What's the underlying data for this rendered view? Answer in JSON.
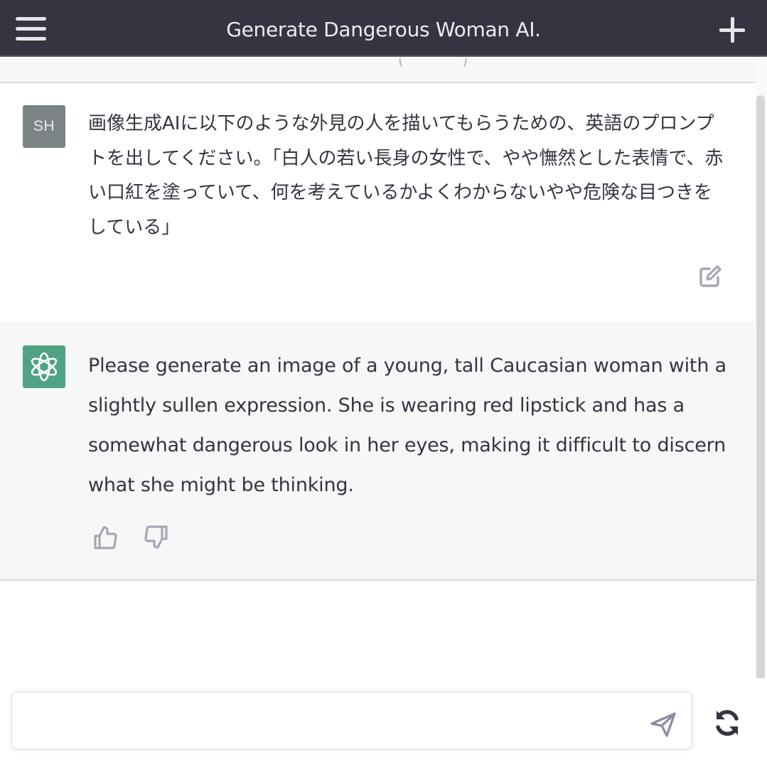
{
  "header": {
    "title": "Generate Dangerous Woman AI.",
    "menu_icon": "hamburger-menu-icon",
    "new_chat_icon": "plus-icon"
  },
  "messages": [
    {
      "role": "user",
      "avatar_initials": "SH",
      "text": "画像生成AIに以下のような外見の人を描いてもらうための、英語のプロンプトを出してください。「白人の若い長身の女性で、やや憮然とした表情で、赤い口紅を塗っていて、何を考えているかよくわからないやや危険な目つきをしている」",
      "action_icon": "edit-icon"
    },
    {
      "role": "assistant",
      "avatar_icon": "openai-logo-icon",
      "text": "Please generate an image of a young, tall Caucasian woman with a slightly sullen expression. She is wearing red lipstick and has a somewhat dangerous look in her eyes, making it difficult to discern what she might be thinking.",
      "feedback_icons": [
        "thumbs-up-icon",
        "thumbs-down-icon"
      ]
    }
  ],
  "composer": {
    "value": "",
    "placeholder": "",
    "send_icon": "send-icon",
    "regenerate_icon": "refresh-icon"
  },
  "colors": {
    "header_bg": "#343541",
    "assistant_row_bg": "#f7f7f8",
    "assistant_avatar": "#4ea383",
    "user_avatar": "#7c8486",
    "icon_gray": "#a6a6b4"
  }
}
